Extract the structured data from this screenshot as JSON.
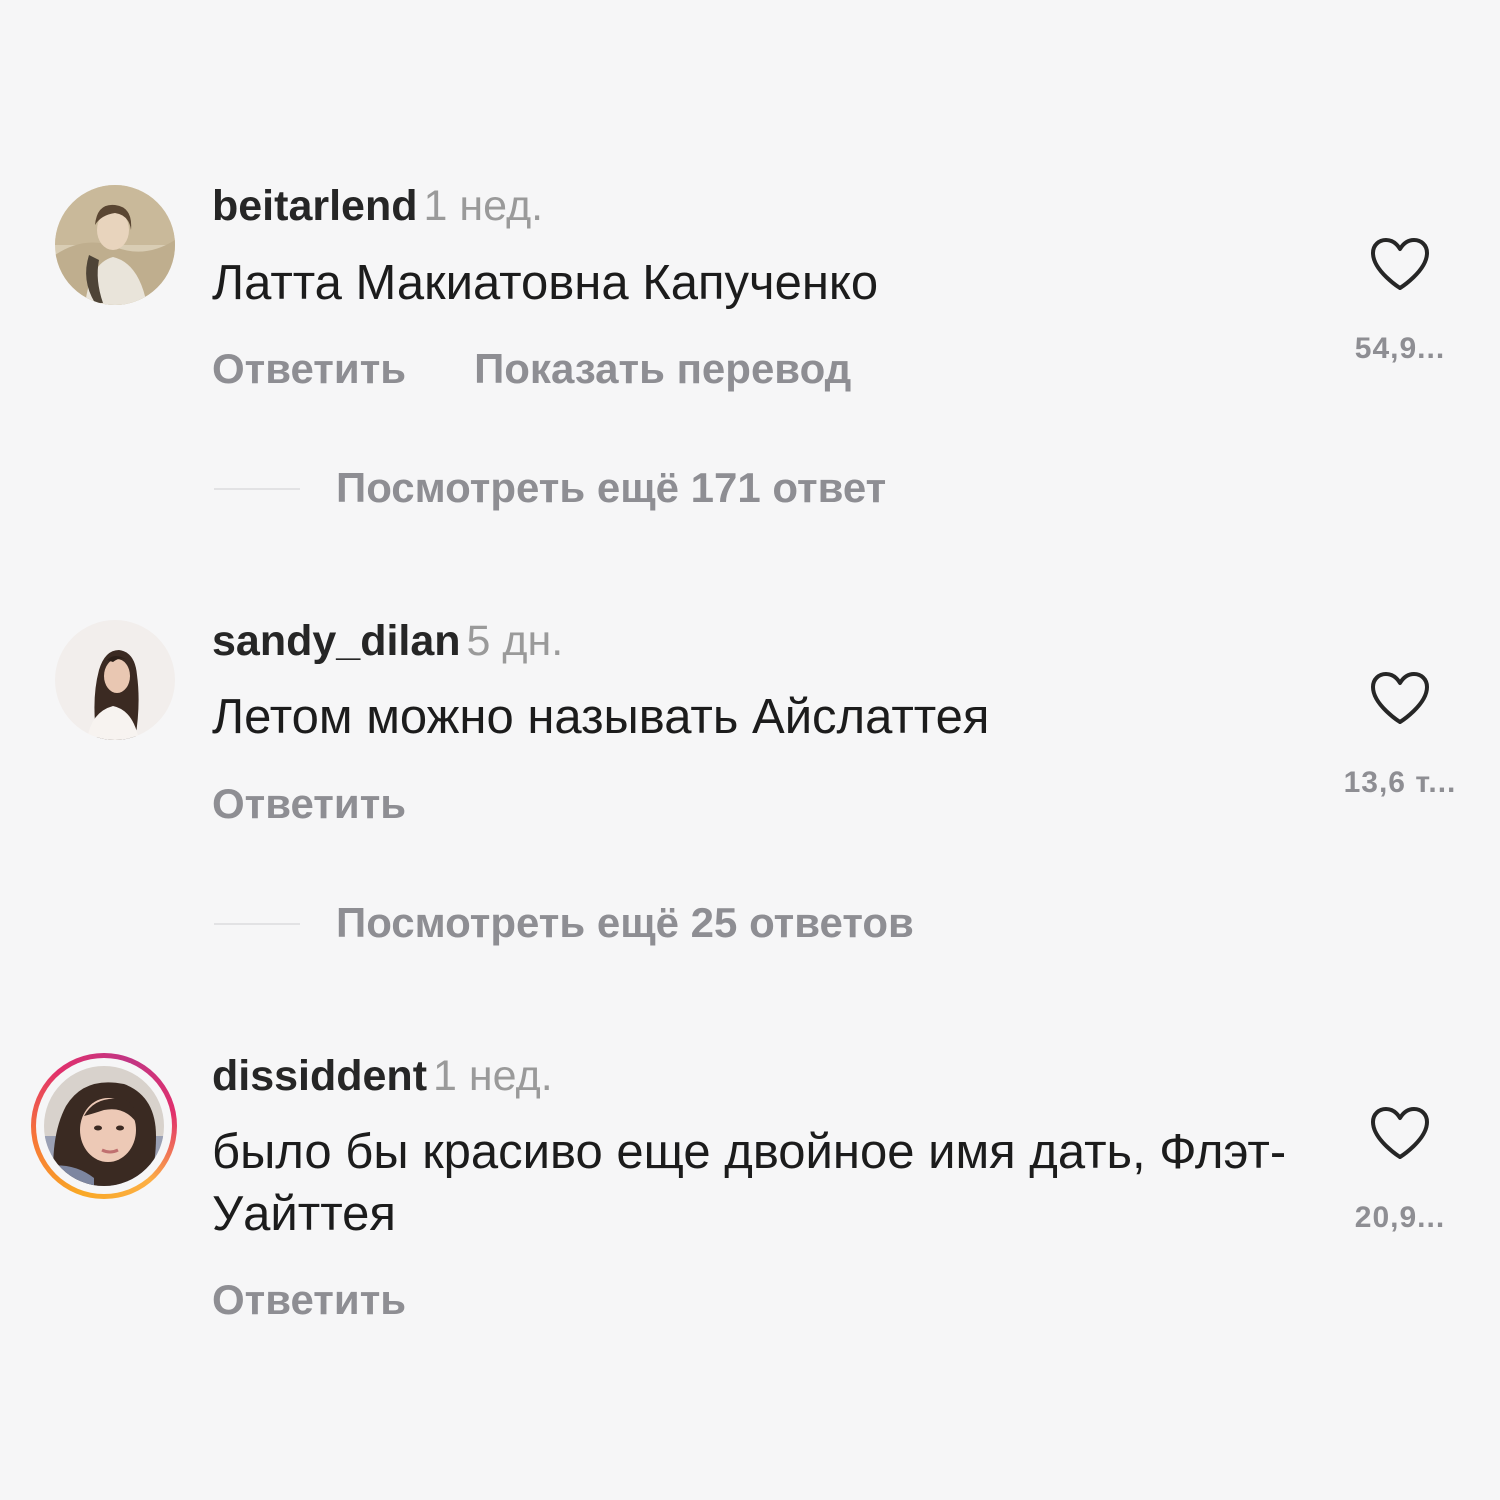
{
  "comments": [
    {
      "username": "beitarlend",
      "time": "1 нед.",
      "text": "Латта Макиатовна Капученко",
      "reply_label": "Ответить",
      "translate_label": "Показать перевод",
      "likes": "54,9...",
      "has_story": false,
      "view_replies": "Посмотреть ещё 171 ответ"
    },
    {
      "username": "sandy_dilan",
      "time": "5 дн.",
      "text": "Летом можно называть Айслаттея",
      "reply_label": "Ответить",
      "likes": "13,6 т...",
      "has_story": false,
      "view_replies": "Посмотреть ещё 25 ответов"
    },
    {
      "username": "dissiddent",
      "time": "1 нед.",
      "text": "было бы красиво еще двойное имя дать, Флэт-Уайттея",
      "reply_label": "Ответить",
      "likes": "20,9...",
      "has_story": true
    }
  ],
  "colors": {
    "background": "#f6f6f7",
    "secondary_text": "#8e8e93",
    "primary_text": "#1c1c1c",
    "heart_outline": "#262626"
  }
}
